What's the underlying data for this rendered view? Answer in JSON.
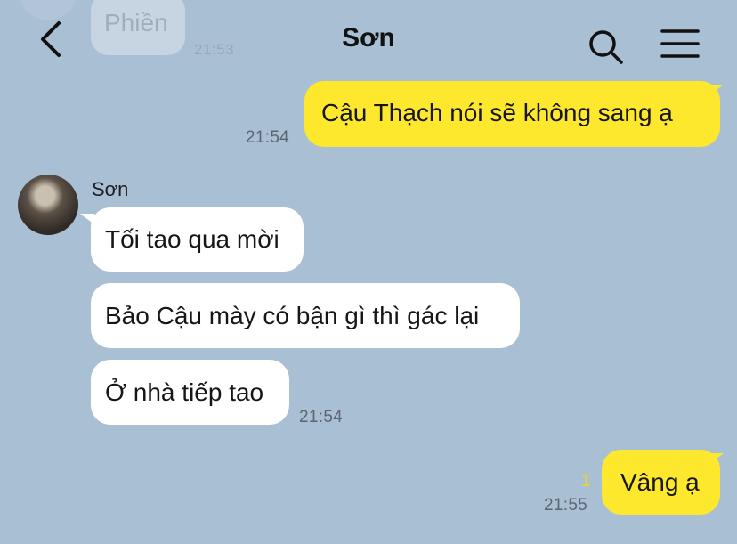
{
  "header": {
    "title": "Sơn"
  },
  "previous": {
    "text": "Phiền",
    "time": "21:53"
  },
  "messages": {
    "out1": {
      "text": "Cậu Thạch nói sẽ không sang ạ",
      "time": "21:54"
    },
    "sender_name": "Sơn",
    "in1": {
      "text": "Tối tao qua mời"
    },
    "in2": {
      "text": "Bảo Cậu mày có bận gì thì gác lại"
    },
    "in3": {
      "text": "Ở nhà tiếp tao",
      "time": "21:54"
    },
    "out2": {
      "text": "Vâng ạ",
      "time": "21:55",
      "unread": "1"
    }
  },
  "colors": {
    "background": "#a9bfd4",
    "outgoing_bubble": "#fde82e",
    "incoming_bubble": "#ffffff",
    "unread_count": "#f2d61c"
  },
  "icons": [
    "back-icon",
    "search-icon",
    "menu-icon"
  ]
}
